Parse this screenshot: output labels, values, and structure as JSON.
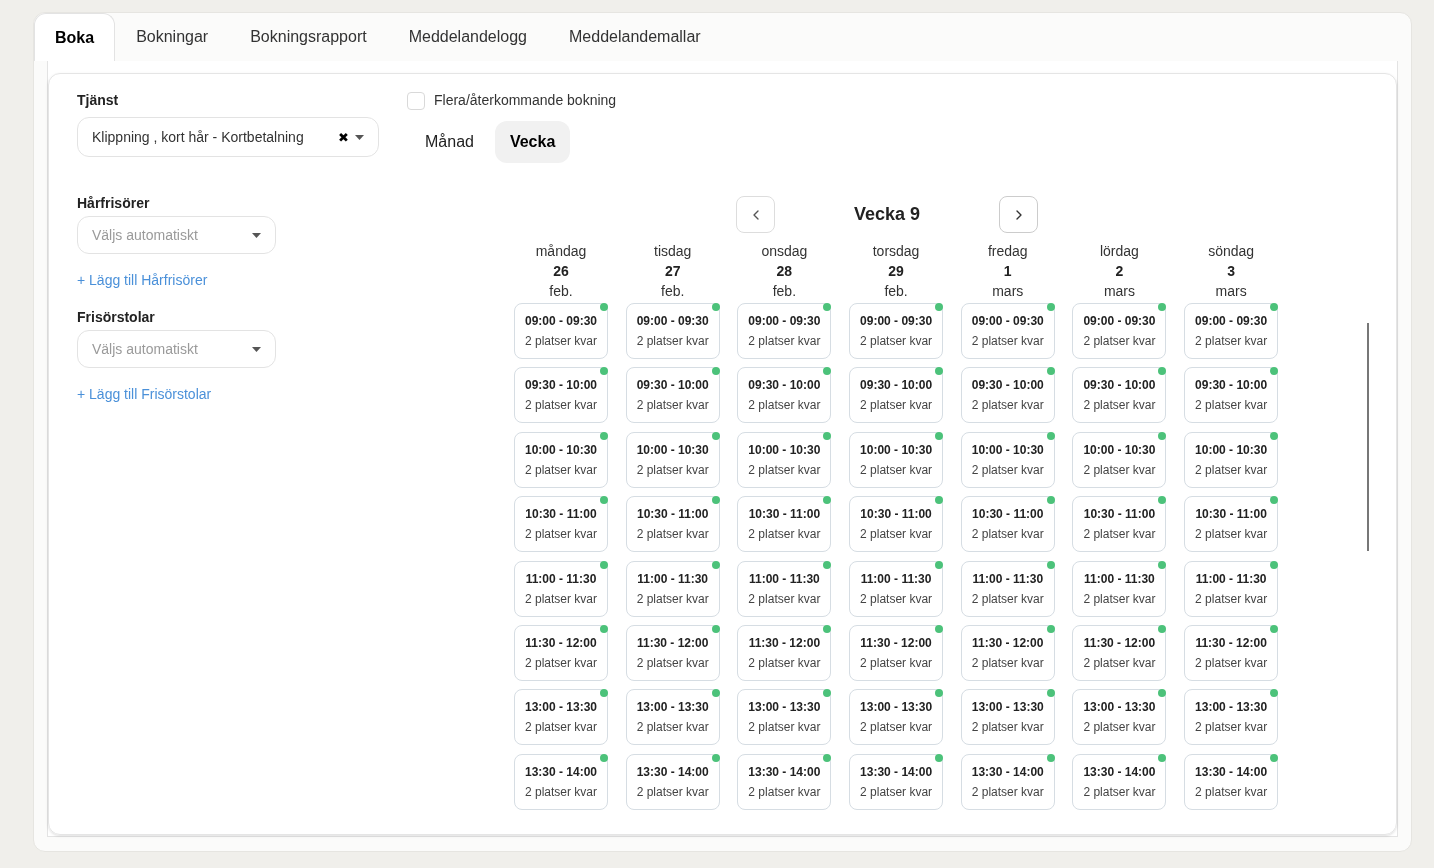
{
  "tabs": [
    {
      "label": "Boka",
      "selected": true
    },
    {
      "label": "Bokningar",
      "selected": false
    },
    {
      "label": "Bokningsrapport",
      "selected": false
    },
    {
      "label": "Meddelandelogg",
      "selected": false
    },
    {
      "label": "Meddelandemallar",
      "selected": false
    }
  ],
  "service": {
    "label": "Tjänst",
    "value": "Klippning , kort hår - Kortbetalning",
    "clear_icon": "✖"
  },
  "fields": [
    {
      "label": "Hårfrisörer",
      "placeholder": "Väljs automatiskt",
      "add_link": "+ Lägg till Hårfrisörer"
    },
    {
      "label": "Frisörstolar",
      "placeholder": "Väljs automatiskt",
      "add_link": "+ Lägg till Frisörstolar"
    }
  ],
  "recurring": {
    "label": "Flera/återkommande bokning",
    "checked": false
  },
  "views": [
    {
      "label": "Månad",
      "selected": false
    },
    {
      "label": "Vecka",
      "selected": true
    }
  ],
  "week_title": "Vecka 9",
  "days": [
    {
      "weekday": "måndag",
      "date": "26",
      "month": "feb.",
      "slots": [
        {
          "time": "09:00 - 09:30",
          "remaining": "2 platser kvar",
          "available": true
        },
        {
          "time": "09:30 - 10:00",
          "remaining": "2 platser kvar",
          "available": true
        },
        {
          "time": "10:00 - 10:30",
          "remaining": "2 platser kvar",
          "available": true
        },
        {
          "time": "10:30 - 11:00",
          "remaining": "2 platser kvar",
          "available": true
        },
        {
          "time": "11:00 - 11:30",
          "remaining": "2 platser kvar",
          "available": true
        },
        {
          "time": "11:30 - 12:00",
          "remaining": "2 platser kvar",
          "available": true
        },
        {
          "time": "13:00 - 13:30",
          "remaining": "2 platser kvar",
          "available": true
        },
        {
          "time": "13:30 - 14:00",
          "remaining": "2 platser kvar",
          "available": true
        }
      ]
    },
    {
      "weekday": "tisdag",
      "date": "27",
      "month": "feb.",
      "slots": [
        {
          "time": "09:00 - 09:30",
          "remaining": "2 platser kvar",
          "available": true
        },
        {
          "time": "09:30 - 10:00",
          "remaining": "2 platser kvar",
          "available": true
        },
        {
          "time": "10:00 - 10:30",
          "remaining": "2 platser kvar",
          "available": true
        },
        {
          "time": "10:30 - 11:00",
          "remaining": "2 platser kvar",
          "available": true
        },
        {
          "time": "11:00 - 11:30",
          "remaining": "2 platser kvar",
          "available": true
        },
        {
          "time": "11:30 - 12:00",
          "remaining": "2 platser kvar",
          "available": true
        },
        {
          "time": "13:00 - 13:30",
          "remaining": "2 platser kvar",
          "available": true
        },
        {
          "time": "13:30 - 14:00",
          "remaining": "2 platser kvar",
          "available": true
        }
      ]
    },
    {
      "weekday": "onsdag",
      "date": "28",
      "month": "feb.",
      "slots": [
        {
          "time": "09:00 - 09:30",
          "remaining": "2 platser kvar",
          "available": true
        },
        {
          "time": "09:30 - 10:00",
          "remaining": "2 platser kvar",
          "available": true
        },
        {
          "time": "10:00 - 10:30",
          "remaining": "2 platser kvar",
          "available": true
        },
        {
          "time": "10:30 - 11:00",
          "remaining": "2 platser kvar",
          "available": true
        },
        {
          "time": "11:00 - 11:30",
          "remaining": "2 platser kvar",
          "available": true
        },
        {
          "time": "11:30 - 12:00",
          "remaining": "2 platser kvar",
          "available": true
        },
        {
          "time": "13:00 - 13:30",
          "remaining": "2 platser kvar",
          "available": true
        },
        {
          "time": "13:30 - 14:00",
          "remaining": "2 platser kvar",
          "available": true
        }
      ]
    },
    {
      "weekday": "torsdag",
      "date": "29",
      "month": "feb.",
      "slots": [
        {
          "time": "09:00 - 09:30",
          "remaining": "2 platser kvar",
          "available": true
        },
        {
          "time": "09:30 - 10:00",
          "remaining": "2 platser kvar",
          "available": true
        },
        {
          "time": "10:00 - 10:30",
          "remaining": "2 platser kvar",
          "available": true
        },
        {
          "time": "10:30 - 11:00",
          "remaining": "2 platser kvar",
          "available": true
        },
        {
          "time": "11:00 - 11:30",
          "remaining": "2 platser kvar",
          "available": true
        },
        {
          "time": "11:30 - 12:00",
          "remaining": "2 platser kvar",
          "available": true
        },
        {
          "time": "13:00 - 13:30",
          "remaining": "2 platser kvar",
          "available": true
        },
        {
          "time": "13:30 - 14:00",
          "remaining": "2 platser kvar",
          "available": true
        }
      ]
    },
    {
      "weekday": "fredag",
      "date": "1",
      "month": "mars",
      "slots": [
        {
          "time": "09:00 - 09:30",
          "remaining": "2 platser kvar",
          "available": true
        },
        {
          "time": "09:30 - 10:00",
          "remaining": "2 platser kvar",
          "available": true
        },
        {
          "time": "10:00 - 10:30",
          "remaining": "2 platser kvar",
          "available": true
        },
        {
          "time": "10:30 - 11:00",
          "remaining": "2 platser kvar",
          "available": true
        },
        {
          "time": "11:00 - 11:30",
          "remaining": "2 platser kvar",
          "available": true
        },
        {
          "time": "11:30 - 12:00",
          "remaining": "2 platser kvar",
          "available": true
        },
        {
          "time": "13:00 - 13:30",
          "remaining": "2 platser kvar",
          "available": true
        },
        {
          "time": "13:30 - 14:00",
          "remaining": "2 platser kvar",
          "available": true
        }
      ]
    },
    {
      "weekday": "lördag",
      "date": "2",
      "month": "mars",
      "slots": [
        {
          "time": "09:00 - 09:30",
          "remaining": "2 platser kvar",
          "available": true
        },
        {
          "time": "09:30 - 10:00",
          "remaining": "2 platser kvar",
          "available": true
        },
        {
          "time": "10:00 - 10:30",
          "remaining": "2 platser kvar",
          "available": true
        },
        {
          "time": "10:30 - 11:00",
          "remaining": "2 platser kvar",
          "available": true
        },
        {
          "time": "11:00 - 11:30",
          "remaining": "2 platser kvar",
          "available": true
        },
        {
          "time": "11:30 - 12:00",
          "remaining": "2 platser kvar",
          "available": true
        },
        {
          "time": "13:00 - 13:30",
          "remaining": "2 platser kvar",
          "available": true
        },
        {
          "time": "13:30 - 14:00",
          "remaining": "2 platser kvar",
          "available": true
        }
      ]
    },
    {
      "weekday": "söndag",
      "date": "3",
      "month": "mars",
      "slots": [
        {
          "time": "09:00 - 09:30",
          "remaining": "2 platser kvar",
          "available": true
        },
        {
          "time": "09:30 - 10:00",
          "remaining": "2 platser kvar",
          "available": true
        },
        {
          "time": "10:00 - 10:30",
          "remaining": "2 platser kvar",
          "available": true
        },
        {
          "time": "10:30 - 11:00",
          "remaining": "2 platser kvar",
          "available": true
        },
        {
          "time": "11:00 - 11:30",
          "remaining": "2 platser kvar",
          "available": true
        },
        {
          "time": "11:30 - 12:00",
          "remaining": "2 platser kvar",
          "available": true
        },
        {
          "time": "13:00 - 13:30",
          "remaining": "2 platser kvar",
          "available": true
        },
        {
          "time": "13:30 - 14:00",
          "remaining": "2 platser kvar",
          "available": true
        }
      ]
    }
  ]
}
